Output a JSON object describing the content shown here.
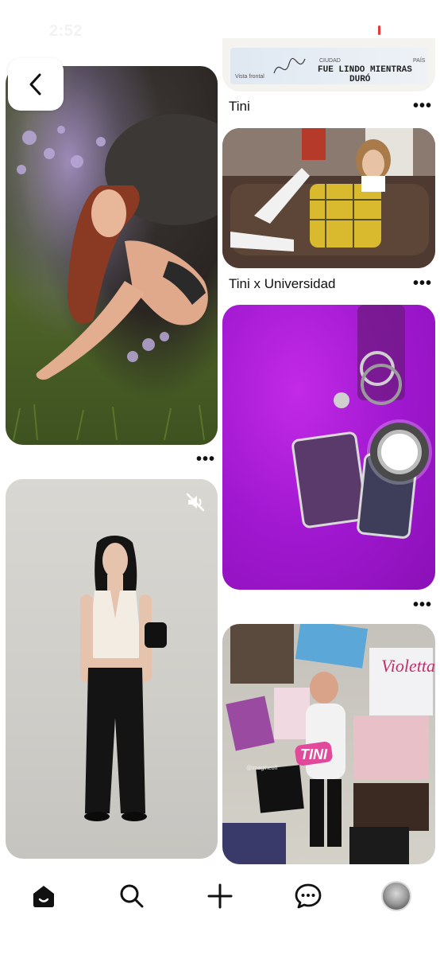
{
  "status_bar": {
    "time": "2:52"
  },
  "pins": {
    "id_card": {
      "card_label_vista": "Vista frontal",
      "card_label_ciudad": "CIUDAD",
      "card_label_pais": "PAÍS",
      "card_text_line1": "FUE LINDO MIENTRAS",
      "card_text_line2": "DURÓ",
      "title": "Tini",
      "more": "•••"
    },
    "grass": {
      "more": "•••"
    },
    "universidad": {
      "title": "Tini x Universidad",
      "more": "•••"
    },
    "purple": {
      "more": "•••"
    },
    "collage": {
      "violetta_text": "Violetta",
      "tini_sticker": "TINI",
      "watermark": "@imagineoff"
    }
  },
  "nav": {
    "items": [
      "home-icon",
      "search-icon",
      "plus-icon",
      "messages-icon",
      "profile-avatar"
    ]
  },
  "colors": {
    "accent": "#111111",
    "purple_pin": "#b020dc"
  }
}
